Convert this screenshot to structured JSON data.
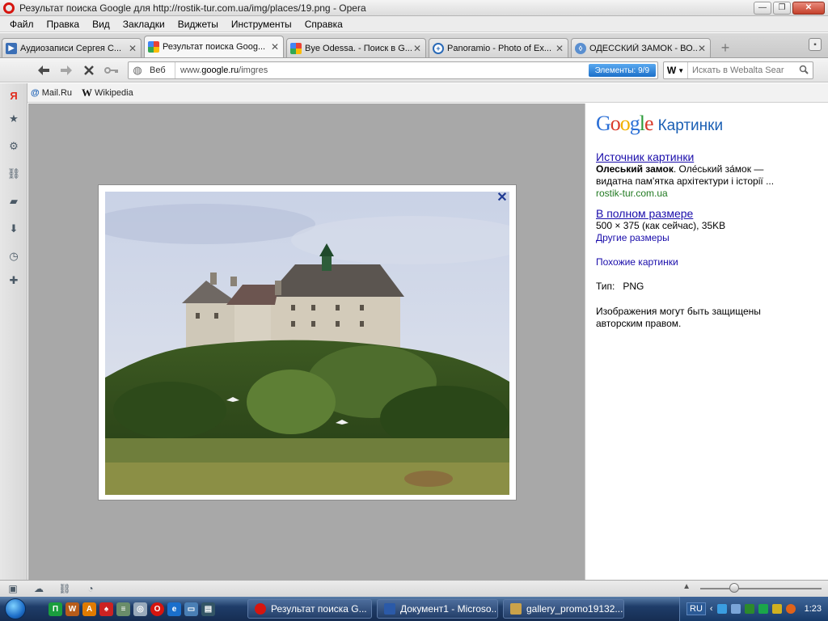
{
  "window": {
    "title": "Результат поиска Google для http://rostik-tur.com.ua/img/places/19.png - Opera"
  },
  "menu": [
    "Файл",
    "Правка",
    "Вид",
    "Закладки",
    "Виджеты",
    "Инструменты",
    "Справка"
  ],
  "tabs": [
    {
      "label": "Аудиозаписи Сергея С...",
      "icon": "play-icon",
      "color": "#3b6fb6"
    },
    {
      "label": "Результат поиска Goog...",
      "icon": "google-icon",
      "color": "#4285f4",
      "active": true
    },
    {
      "label": "Bye Odessa. - Поиск в G...",
      "icon": "google-icon",
      "color": "#4285f4"
    },
    {
      "label": "Panoramio - Photo of Ex...",
      "icon": "panoramio-icon",
      "color": "#2a6ab7"
    },
    {
      "label": "ОДЕССКИЙ ЗАМОК - ВО...",
      "icon": "lock-icon",
      "color": "#5a8fd0"
    }
  ],
  "address": {
    "mode_label": "Веб",
    "url_prefix": "www.",
    "url_domain": "google.ru",
    "url_path": "/imgres",
    "elements_badge": "Элементы:  9/9",
    "search_engine_icon": "W",
    "search_placeholder": "Искать в Webalta Sear"
  },
  "bookmarks": [
    {
      "label": "Mail.Ru",
      "icon": "@"
    },
    {
      "label": "Wikipedia",
      "icon": "W"
    }
  ],
  "info": {
    "logo_google": "Google",
    "logo_images": "Картинки",
    "source_link": "Источник картинки",
    "source_title_bold": "Олеський замок",
    "source_snippet_1": ". Оле́ський за́мок —",
    "source_snippet_2": "видатна пам'ятка архітектури і історії ...",
    "source_domain": "rostik-tur.com.ua",
    "fullsize_link": "В полном размере",
    "size_text": "500 × 375 (как сейчас), 35KB",
    "other_sizes": "Другие размеры",
    "similar": "Похожие картинки",
    "type_label": "Тип:",
    "type_value": "PNG",
    "copyright_1": "Изображения могут быть защищены",
    "copyright_2": "авторским правом."
  },
  "taskbar": {
    "tasks": [
      {
        "label": "Результат поиска G...",
        "color": "#d6150f"
      },
      {
        "label": "Документ1 - Microso...",
        "color": "#2b5aa8"
      },
      {
        "label": "gallery_promo19132...",
        "color": "#caa24a"
      }
    ],
    "lang": "RU",
    "clock": "1:23"
  }
}
